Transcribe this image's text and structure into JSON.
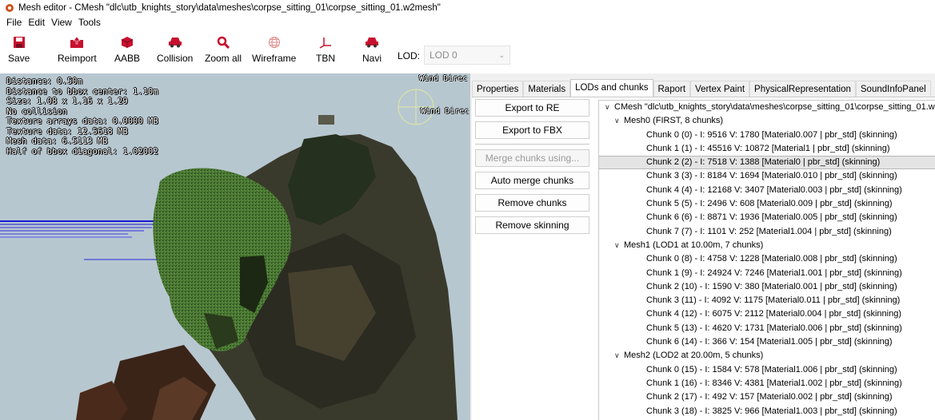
{
  "window": {
    "title": "Mesh editor - CMesh \"dlc\\utb_knights_story\\data\\meshes\\corpse_sitting_01\\corpse_sitting_01.w2mesh\""
  },
  "menu": [
    "File",
    "Edit",
    "View",
    "Tools"
  ],
  "toolbar": {
    "save": "Save",
    "reimport": "Reimport",
    "aabb": "AABB",
    "collision": "Collision",
    "zoom_all": "Zoom all",
    "wireframe": "Wireframe",
    "tbn": "TBN",
    "navi": "Navi",
    "lod_label": "LOD:",
    "lod_value": "LOD 0"
  },
  "viewport": {
    "stats": [
      "Distance: 0.50m",
      "Distance to bbox center: 1.10m",
      "Size: 1.08 x 1.16 x 1.29",
      "No collision",
      "Texture arrays data: 0.0000 MB",
      "Texture data: 12.5618 MB",
      "Mesh data: 6.5113 MB",
      "Half of bbox diagonal: 1.02002"
    ],
    "wind_label_1": "Wind Direc",
    "wind_label_2": "Wind Direc"
  },
  "tabs": [
    "Properties",
    "Materials",
    "LODs and chunks",
    "Raport",
    "Vertex Paint",
    "PhysicalRepresentation",
    "SoundInfoPanel"
  ],
  "actions": {
    "export_re": "Export to RE",
    "export_fbx": "Export to FBX",
    "merge_using": "Merge chunks using...",
    "auto_merge": "Auto merge chunks",
    "remove_chunks": "Remove chunks",
    "remove_skinning": "Remove skinning"
  },
  "tree": [
    {
      "level": 0,
      "expand": true,
      "text": "CMesh \"dlc\\utb_knights_story\\data\\meshes\\corpse_sitting_01\\corpse_sitting_01.w2mesh\""
    },
    {
      "level": 1,
      "expand": true,
      "text": "Mesh0 (FIRST, 8 chunks)"
    },
    {
      "level": 2,
      "text": "Chunk 0 (0) - I: 9516 V: 1780 [Material0.007 | pbr_std] (skinning)"
    },
    {
      "level": 2,
      "text": "Chunk 1 (1) - I: 45516 V: 10872 [Material1 | pbr_std] (skinning)"
    },
    {
      "level": 2,
      "selected": true,
      "text": "Chunk 2 (2) - I: 7518 V: 1388 [Material0 | pbr_std] (skinning)"
    },
    {
      "level": 2,
      "text": "Chunk 3 (3) - I: 8184 V: 1694 [Material0.010 | pbr_std] (skinning)"
    },
    {
      "level": 2,
      "text": "Chunk 4 (4) - I: 12168 V: 3407 [Material0.003 | pbr_std] (skinning)"
    },
    {
      "level": 2,
      "text": "Chunk 5 (5) - I: 2496 V: 608 [Material0.009 | pbr_std] (skinning)"
    },
    {
      "level": 2,
      "text": "Chunk 6 (6) - I: 8871 V: 1936 [Material0.005 | pbr_std] (skinning)"
    },
    {
      "level": 2,
      "text": "Chunk 7 (7) - I: 1101 V: 252 [Material1.004 | pbr_std] (skinning)"
    },
    {
      "level": 1,
      "expand": true,
      "text": "Mesh1 (LOD1 at 10.00m, 7 chunks)"
    },
    {
      "level": 2,
      "text": "Chunk 0 (8) - I: 4758 V: 1228 [Material0.008 | pbr_std] (skinning)"
    },
    {
      "level": 2,
      "text": "Chunk 1 (9) - I: 24924 V: 7246 [Material1.001 | pbr_std] (skinning)"
    },
    {
      "level": 2,
      "text": "Chunk 2 (10) - I: 1590 V: 380 [Material0.001 | pbr_std] (skinning)"
    },
    {
      "level": 2,
      "text": "Chunk 3 (11) - I: 4092 V: 1175 [Material0.011 | pbr_std] (skinning)"
    },
    {
      "level": 2,
      "text": "Chunk 4 (12) - I: 6075 V: 2112 [Material0.004 | pbr_std] (skinning)"
    },
    {
      "level": 2,
      "text": "Chunk 5 (13) - I: 4620 V: 1731 [Material0.006 | pbr_std] (skinning)"
    },
    {
      "level": 2,
      "text": "Chunk 6 (14) - I: 366 V: 154 [Material1.005 | pbr_std] (skinning)"
    },
    {
      "level": 1,
      "expand": true,
      "text": "Mesh2 (LOD2 at 20.00m, 5 chunks)"
    },
    {
      "level": 2,
      "text": "Chunk 0 (15) - I: 1584 V: 578 [Material1.006 | pbr_std] (skinning)"
    },
    {
      "level": 2,
      "text": "Chunk 1 (16) - I: 8346 V: 4381 [Material1.002 | pbr_std] (skinning)"
    },
    {
      "level": 2,
      "text": "Chunk 2 (17) - I: 492 V: 157 [Material0.002 | pbr_std] (skinning)"
    },
    {
      "level": 2,
      "text": "Chunk 3 (18) - I: 3825 V: 966 [Material1.003 | pbr_std] (skinning)"
    }
  ]
}
